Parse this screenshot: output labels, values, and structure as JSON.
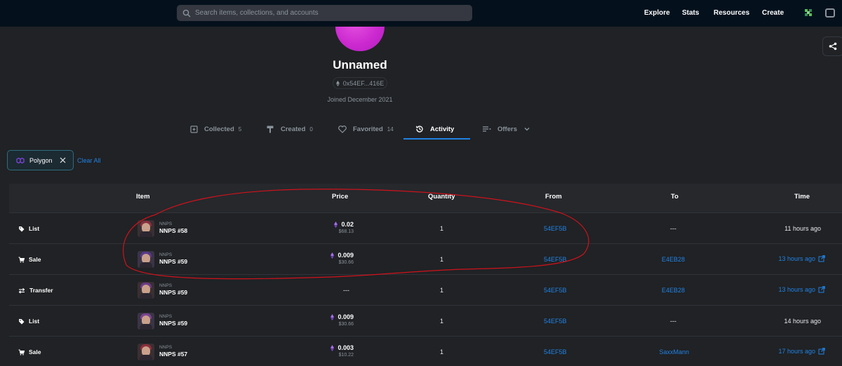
{
  "header": {
    "search_placeholder": "Search items, collections, and accounts",
    "nav": [
      "Explore",
      "Stats",
      "Resources",
      "Create"
    ]
  },
  "profile": {
    "name": "Unnamed",
    "address": "0x54EF...416E",
    "joined": "Joined December 2021"
  },
  "tabs": [
    {
      "label": "Collected",
      "count": "5"
    },
    {
      "label": "Created",
      "count": "0"
    },
    {
      "label": "Favorited",
      "count": "14"
    },
    {
      "label": "Activity",
      "count": ""
    },
    {
      "label": "Offers",
      "count": ""
    }
  ],
  "active_tab": "Activity",
  "filters": {
    "chip_label": "Polygon",
    "clear_all": "Clear All"
  },
  "table": {
    "headers": [
      "Item",
      "Price",
      "Quantity",
      "From",
      "To",
      "Time"
    ],
    "rows": [
      {
        "event": "List",
        "event_icon": "tag-icon",
        "collection": "NNPS",
        "item": "NNPS #58",
        "price": "0.02",
        "usd": "$68.13",
        "quantity": "1",
        "from": "54EF5B",
        "to": "---",
        "time": "11 hours ago",
        "time_link": false
      },
      {
        "event": "Sale",
        "event_icon": "cart-icon",
        "collection": "NNPS",
        "item": "NNPS #59",
        "price": "0.009",
        "usd": "$30.66",
        "quantity": "1",
        "from": "54EF5B",
        "to": "E4EB28",
        "time": "13 hours ago",
        "time_link": true
      },
      {
        "event": "Transfer",
        "event_icon": "transfer-icon",
        "collection": "NNPS",
        "item": "NNPS #59",
        "price": "---",
        "usd": "",
        "quantity": "1",
        "from": "54EF5B",
        "to": "E4EB28",
        "time": "13 hours ago",
        "time_link": true
      },
      {
        "event": "List",
        "event_icon": "tag-icon",
        "collection": "NNPS",
        "item": "NNPS #59",
        "price": "0.009",
        "usd": "$30.66",
        "quantity": "1",
        "from": "54EF5B",
        "to": "---",
        "time": "14 hours ago",
        "time_link": false
      },
      {
        "event": "Sale",
        "event_icon": "cart-icon",
        "collection": "NNPS",
        "item": "NNPS #57",
        "price": "0.003",
        "usd": "$10.22",
        "quantity": "1",
        "from": "54EF5B",
        "to": "SaxxMann",
        "time": "17 hours ago",
        "time_link": true
      }
    ]
  },
  "colors": {
    "accent": "#2081e2",
    "background": "#202225",
    "topbar": "#04111d",
    "annotation": "#d0121b",
    "polygon": "#8247e5"
  }
}
